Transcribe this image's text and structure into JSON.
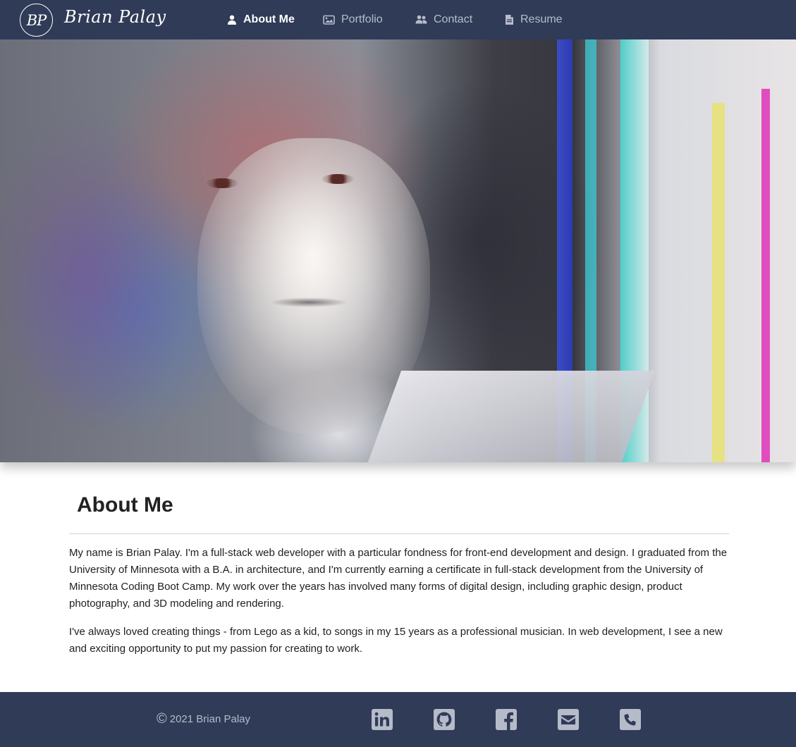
{
  "brand": {
    "monogram": "BP",
    "name": "Brian Palay"
  },
  "nav": [
    {
      "label": "About Me",
      "icon": "person-icon",
      "active": true
    },
    {
      "label": "Portfolio",
      "icon": "image-icon",
      "active": false
    },
    {
      "label": "Contact",
      "icon": "people-icon",
      "active": false
    },
    {
      "label": "Resume",
      "icon": "document-icon",
      "active": false
    }
  ],
  "hero": {
    "alt": "Portrait of Brian Palay with chromatic glitch effect"
  },
  "about": {
    "title": "About Me",
    "paragraphs": [
      "My name is Brian Palay. I'm a full-stack web developer with a particular fondness for front-end development and design. I graduated from the University of Minnesota with a B.A. in architecture, and I'm currently earning a certificate in full-stack development from the University of Minnesota Coding Boot Camp. My work over the years has involved many forms of digital design, including graphic design, product photography, and 3D modeling and rendering.",
      "I've always loved creating things - from Lego as a kid, to songs in my 15 years as a professional musician. In web development, I see a new and exciting opportunity to put my passion for creating to work."
    ]
  },
  "footer": {
    "copyright_symbol": "©",
    "copyright": "2021 Brian Palay",
    "social": [
      "linkedin-icon",
      "github-icon",
      "facebook-icon",
      "email-icon",
      "phone-icon"
    ]
  },
  "colors": {
    "nav_bg": "#2f3b57",
    "nav_text": "#b7bdcb",
    "active_text": "#ffffff",
    "footer_icon": "#b5bbc9"
  }
}
